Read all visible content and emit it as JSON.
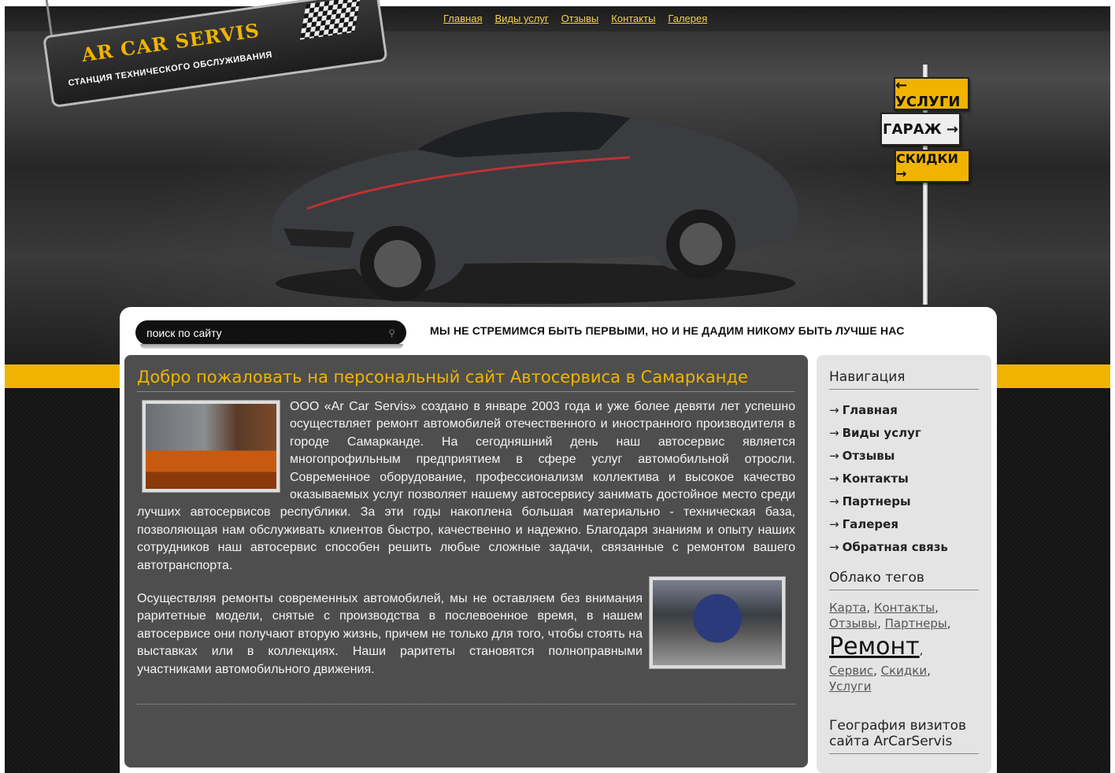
{
  "top_nav": [
    "Главная",
    "Виды услуг",
    "Отзывы",
    "Контакты",
    "Галерея"
  ],
  "logo": {
    "title": "AR CAR SERVIS",
    "subtitle": "СТАНЦИЯ ТЕХНИЧЕСКОГО ОБСЛУЖИВАНИЯ"
  },
  "signs": {
    "services": "← УСЛУГИ",
    "garage": "ГАРАЖ →",
    "discounts": "СКИДКИ →"
  },
  "search": {
    "placeholder": "поиск по сайту"
  },
  "slogan": "МЫ НЕ СТРЕМИМСЯ БЫТЬ ПЕРВЫМИ, НО И НЕ ДАДИМ НИКОМУ БЫТЬ ЛУЧШЕ НАС",
  "main": {
    "title": "Добро пожаловать на персональный сайт Автосервиса в Самарканде",
    "paragraph1": "ООО «Ar Car Servis» создано в январе 2003 года и уже более девяти лет успешно осуществляет ремонт автомобилей отечественного и иностранного производителя в городе Самарканде. На сегодняшний день наш автосервис является многопрофильным предприятием в сфере услуг автомобильной отросли. Современное оборудование, профессионализм коллектива и высокое качество оказываемых услуг позволяет нашему автосервису занимать достойное место среди лучших автосервисов республики. За эти годы накоплена большая материально - техническая база, позволяющая нам обслуживать клиентов быстро, качественно и надежно. Благодаря знаниям и опыту наших сотрудников наш автосервис способен решить любые сложные задачи, связанные с ремонтом вашего автотранспорта.",
    "paragraph2": "Осуществляя ремонты современных автомобилей, мы не оставляем без внимания раритетные модели, снятые с производства в послевоенное время, в нашем автосервисе они получают вторую жизнь, причем не только для того, чтобы стоять на выставках или в коллекциях. Наши раритеты становятся полноправными участниками автомобильного движения."
  },
  "sidebar": {
    "nav_title": "Навигация",
    "nav_items": [
      "Главная",
      "Виды услуг",
      "Отзывы",
      "Контакты",
      "Партнеры",
      "Галерея",
      "Обратная связь"
    ],
    "nav_arrow": "→",
    "tags_title": "Облако тегов",
    "tags": [
      "Карта",
      "Контакты",
      "Отзывы",
      "Партнеры",
      "Ремонт",
      "Сервис",
      "Скидки",
      "Услуги"
    ],
    "geo_title": "География визитов сайта ArCarServis"
  },
  "colors": {
    "accent": "#f0b400",
    "content_bg": "#4e4e4e",
    "sidebar_bg": "#e4e4e4"
  }
}
